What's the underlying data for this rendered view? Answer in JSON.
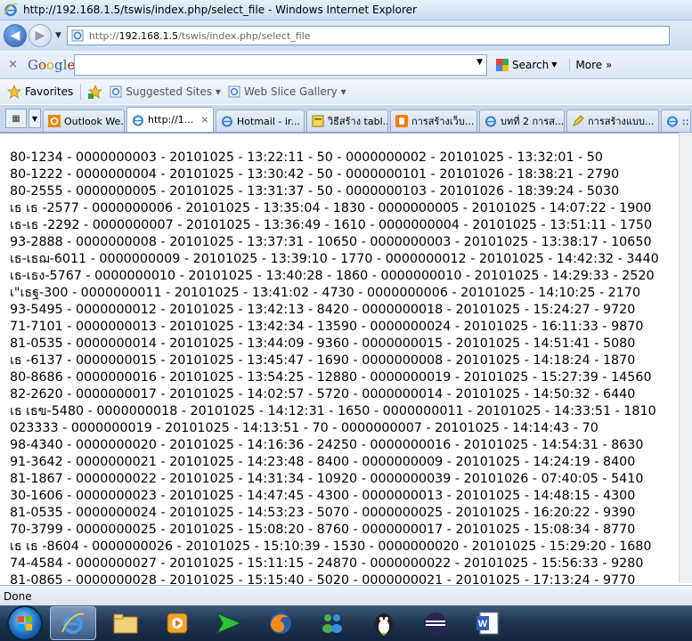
{
  "window": {
    "title": "http://192.168.1.5/tswis/index.php/select_file - Windows Internet Explorer"
  },
  "address": {
    "prefix": "http://",
    "host": "192.168.1.5",
    "path": "/tswis/index.php/select_file"
  },
  "google_toolbar": {
    "logo": "Google",
    "search_label": "Search",
    "more_label": "More »",
    "close": "×"
  },
  "favorites_bar": {
    "favorites_label": "Favorites",
    "items": [
      "Suggested Sites ▾",
      "Web Slice Gallery ▾"
    ]
  },
  "tabs": [
    {
      "label": "Outlook We...",
      "icon": "outlook-icon",
      "active": false
    },
    {
      "label": "http://1...",
      "icon": "ie-page-icon",
      "active": true,
      "close": "×"
    },
    {
      "label": "Hotmail - ir...",
      "icon": "ie-page-icon",
      "active": false
    },
    {
      "label": "วิธีสร้าง tabl...",
      "icon": "tab-page-icon",
      "active": false
    },
    {
      "label": "การสร้างเว็บ...",
      "icon": "blogger-icon",
      "active": false
    },
    {
      "label": "บทที่ 2 การส...",
      "icon": "ie-page-icon",
      "active": false
    },
    {
      "label": "การสร้างแบบ...",
      "icon": "pencil-page-icon",
      "active": false
    },
    {
      "label": "::",
      "icon": "ie-page-icon",
      "active": false
    }
  ],
  "content_lines": [
    "80-1234 - 0000000003 - 20101025 - 13:22:11 - 50 - 0000000002 - 20101025 - 13:32:01 - 50",
    "80-1222 - 0000000004 - 20101025 - 13:30:42 - 50 - 0000000101 - 20101026 - 18:38:21 - 2790",
    "80-2555 - 0000000005 - 20101025 - 13:31:37 - 50 - 0000000103 - 20101026 - 18:39:24 - 5030",
    "เธ เธ -2577 - 0000000006 - 20101025 - 13:35:04 - 1830 - 0000000005 - 20101025 - 14:07:22 - 1900",
    "เธ-เธ -2292 - 0000000007 - 20101025 - 13:36:49 - 1610 - 0000000004 - 20101025 - 13:51:11 - 1750",
    "93-2888 - 0000000008 - 20101025 - 13:37:31 - 10650 - 0000000003 - 20101025 - 13:38:17 - 10650",
    "เธ-เธฌ-6011 - 0000000009 - 20101025 - 13:39:10 - 1770 - 0000000012 - 20101025 - 14:42:32 - 3440",
    "เธ-เธง-5767 - 0000000010 - 20101025 - 13:40:28 - 1860 - 0000000010 - 20101025 - 14:29:33 - 2520",
    "เ\"เธฐ-300 - 0000000011 - 20101025 - 13:41:02 - 4730 - 0000000006 - 20101025 - 14:10:25 - 2170",
    "93-5495 - 0000000012 - 20101025 - 13:42:13 - 8420 - 0000000018 - 20101025 - 15:24:27 - 9720",
    "71-7101 - 0000000013 - 20101025 - 13:42:34 - 13590 - 0000000024 - 20101025 - 16:11:33 - 9870",
    "81-0535 - 0000000014 - 20101025 - 13:44:09 - 9360 - 0000000015 - 20101025 - 14:51:41 - 5080",
    "เธ -6137 - 0000000015 - 20101025 - 13:45:47 - 1690 - 0000000008 - 20101025 - 14:18:24 - 1870",
    "80-8686 - 0000000016 - 20101025 - 13:54:25 - 12880 - 0000000019 - 20101025 - 15:27:39 - 14560",
    "82-2620 - 0000000017 - 20101025 - 14:02:57 - 5720 - 0000000014 - 20101025 - 14:50:32 - 6440",
    "เธ เธข-5480 - 0000000018 - 20101025 - 14:12:31 - 1650 - 0000000011 - 20101025 - 14:33:51 - 1810",
    "023333 - 0000000019 - 20101025 - 14:13:51 - 70 - 0000000007 - 20101025 - 14:14:43 - 70",
    "98-4340 - 0000000020 - 20101025 - 14:16:36 - 24250 - 0000000016 - 20101025 - 14:54:31 - 8630",
    "91-3642 - 0000000021 - 20101025 - 14:23:48 - 8400 - 0000000009 - 20101025 - 14:24:19 - 8400",
    "81-1867 - 0000000022 - 20101025 - 14:31:34 - 10920 - 0000000039 - 20101026 - 07:40:05 - 5410",
    "30-1606 - 0000000023 - 20101025 - 14:47:45 - 4300 - 0000000013 - 20101025 - 14:48:15 - 4300",
    "81-0535 - 0000000024 - 20101025 - 14:53:23 - 5070 - 0000000025 - 20101025 - 16:20:22 - 9390",
    "70-3799 - 0000000025 - 20101025 - 15:08:20 - 8760 - 0000000017 - 20101025 - 15:08:34 - 8770",
    "เธ เธ -8604 - 0000000026 - 20101025 - 15:10:39 - 1530 - 0000000020 - 20101025 - 15:29:20 - 1680",
    "74-4584 - 0000000027 - 20101025 - 15:11:15 - 24870 - 0000000022 - 20101025 - 15:56:33 - 9280",
    "81-0865 - 0000000028 - 20101025 - 15:15:40 - 5020 - 0000000021 - 20101025 - 17:13:24 - 9770"
  ],
  "status": {
    "text": "Done"
  },
  "taskbar": {
    "items": [
      "start-orb-icon",
      "internet-explorer-icon",
      "file-explorer-icon",
      "media-player-icon",
      "green-arrow-app-icon",
      "firefox-icon",
      "messenger-icon",
      "tux-app-icon",
      "eclipse-icon",
      "word-icon"
    ]
  }
}
